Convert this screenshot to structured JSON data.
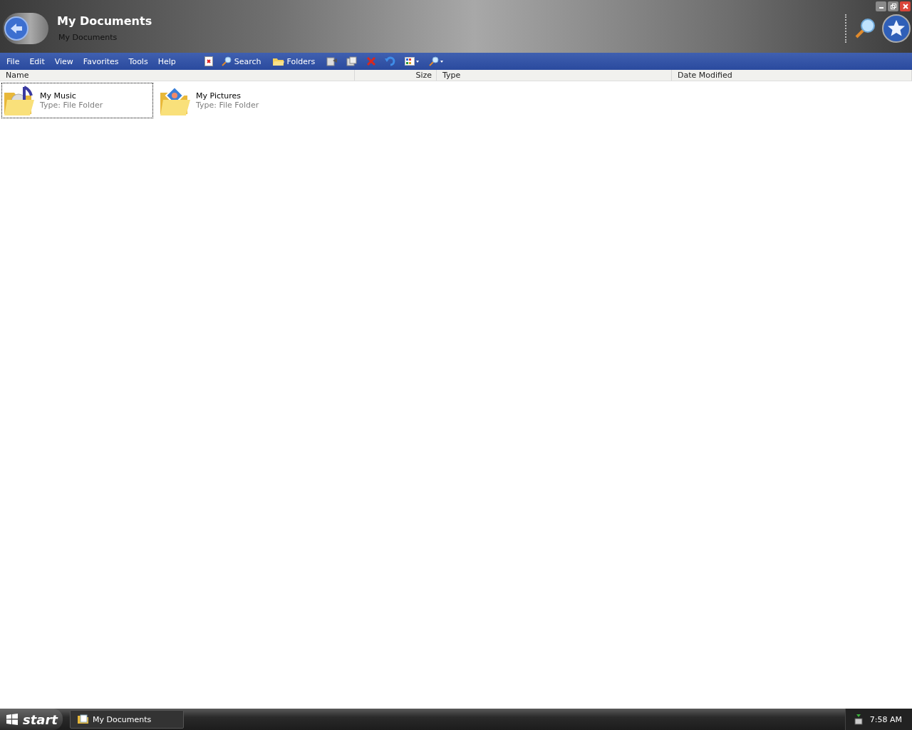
{
  "window": {
    "title": "My Documents",
    "subtitle": "My Documents"
  },
  "menu": [
    "File",
    "Edit",
    "View",
    "Favorites",
    "Tools",
    "Help"
  ],
  "toolbar": {
    "search": "Search",
    "folders": "Folders"
  },
  "columns": [
    "Name",
    "Size",
    "Type",
    "Date Modified"
  ],
  "items": [
    {
      "name": "My Music",
      "type": "Type: File Folder",
      "kind": "music",
      "selected": true
    },
    {
      "name": "My Pictures",
      "type": "Type: File Folder",
      "kind": "pictures",
      "selected": false
    }
  ],
  "taskbar": {
    "start": "start",
    "tasks": [
      {
        "label": "My Documents"
      }
    ],
    "clock": "7:58 AM"
  }
}
